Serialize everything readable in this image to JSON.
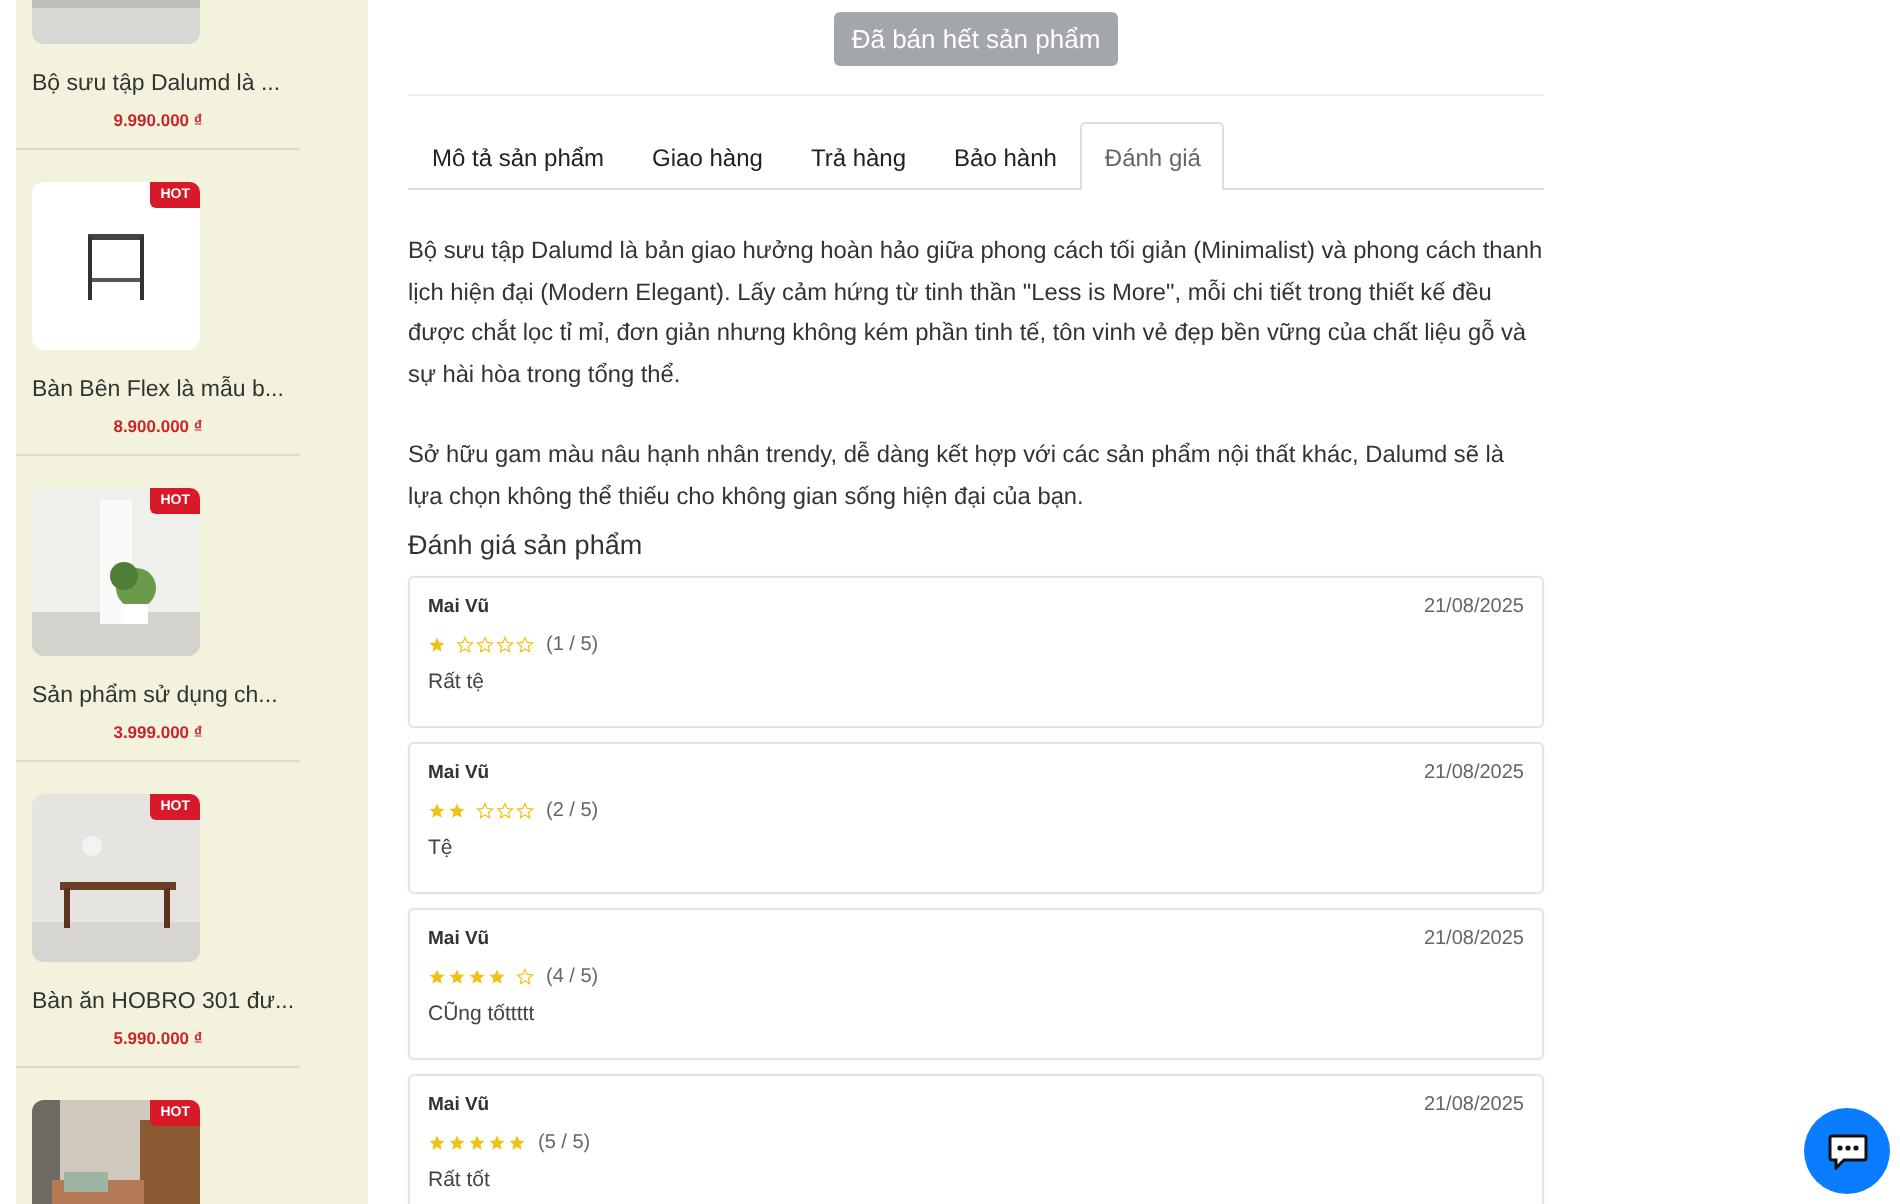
{
  "sidebar": {
    "products": [
      {
        "name": "Bộ sưu tập Dalumd là ...",
        "price": "9.990.000 ₫"
      },
      {
        "name": "Bàn Bên Flex là mẫu b...",
        "price": "8.900.000 ₫",
        "badge": "HOT"
      },
      {
        "name": "Sản phẩm sử dụng ch...",
        "price": "3.999.000 ₫",
        "badge": "HOT"
      },
      {
        "name": "Bàn ăn HOBRO 301 đư...",
        "price": "5.990.000 ₫",
        "badge": "HOT"
      },
      {
        "badge": "HOT"
      }
    ]
  },
  "sold_out_button": {
    "label": "Đã bán hết sản phẩm",
    "disabled": true
  },
  "tabs": [
    {
      "label": "Mô tả sản phẩm",
      "selected": false
    },
    {
      "label": "Giao hàng",
      "selected": false
    },
    {
      "label": "Trả hàng",
      "selected": false
    },
    {
      "label": "Bảo hành",
      "selected": false
    },
    {
      "label": "Đánh giá",
      "selected": true
    }
  ],
  "description": [
    "Bộ sưu tập Dalumd là bản giao hưởng hoàn hảo giữa phong cách tối giản (Minimalist) và phong cách thanh lịch hiện đại (Modern Elegant). Lấy cảm hứng từ tinh thần \"Less is More\", mỗi chi tiết trong thiết kế đều được chắt lọc tỉ mỉ, đơn giản nhưng không kém phần tinh tế, tôn vinh vẻ đẹp bền vững của chất liệu gỗ và sự hài hòa trong tổng thể.",
    "Sở hữu gam màu nâu hạnh nhân trendy, dễ dàng kết hợp với các sản phẩm nội thất khác, Dalumd sẽ là lựa chọn không thể thiếu cho không gian sống hiện đại của bạn."
  ],
  "reviews_heading": "Đánh giá sản phẩm",
  "reviews": [
    {
      "author": "Mai Vũ",
      "date": "21/08/2025",
      "stars": 1,
      "rating": "(1 / 5)",
      "comment": "Rất tệ"
    },
    {
      "author": "Mai Vũ",
      "date": "21/08/2025",
      "stars": 2,
      "rating": "(2 / 5)",
      "comment": "Tệ"
    },
    {
      "author": "Mai Vũ",
      "date": "21/08/2025",
      "stars": 4,
      "rating": "(4 / 5)",
      "comment": "CŨng tốttttt"
    },
    {
      "author": "Mai Vũ",
      "date": "21/08/2025",
      "stars": 5,
      "rating": "(5 / 5)",
      "comment": "Rất tốt"
    }
  ],
  "chat_button": {
    "kind": "chat"
  }
}
